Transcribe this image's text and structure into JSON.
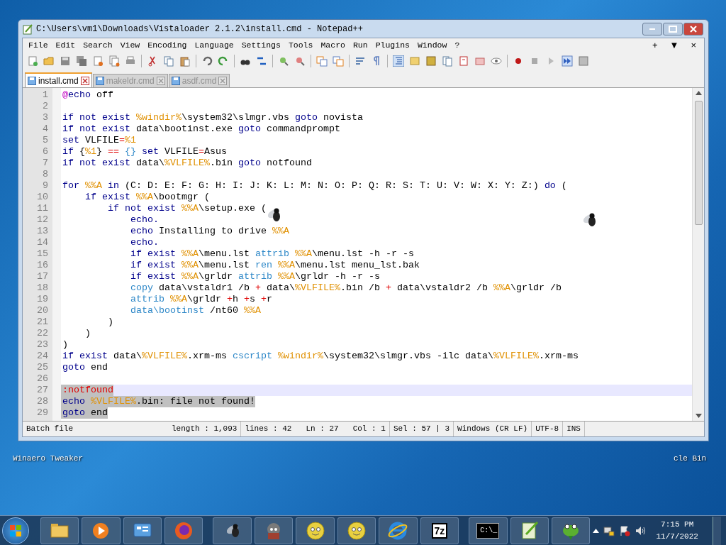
{
  "window": {
    "title": "C:\\Users\\vm1\\Downloads\\Vistaloader 2.1.2\\install.cmd - Notepad++"
  },
  "menu": [
    "File",
    "Edit",
    "Search",
    "View",
    "Encoding",
    "Language",
    "Settings",
    "Tools",
    "Macro",
    "Run",
    "Plugins",
    "Window",
    "?"
  ],
  "menu_right": [
    "+",
    "▼",
    "×"
  ],
  "tabs": [
    {
      "label": "install.cmd",
      "selected": true
    },
    {
      "label": "makeldr.cmd",
      "selected": false
    },
    {
      "label": "asdf.cmd",
      "selected": false
    }
  ],
  "editor": {
    "lines": [
      {
        "number": "1",
        "selected": false,
        "current": false,
        "segments": [
          {
            "text": "@",
            "kind": "at"
          },
          {
            "text": "echo",
            "kind": "kw"
          },
          {
            "text": " off",
            "kind": "p"
          }
        ]
      },
      {
        "number": "2",
        "selected": false,
        "current": false
      },
      {
        "number": "3",
        "selected": false,
        "current": false,
        "segments": [
          {
            "text": "if not exist ",
            "kind": "kw"
          },
          {
            "text": "%windir%",
            "kind": "var"
          },
          {
            "text": "\\system32\\slmgr.vbs ",
            "kind": "p"
          },
          {
            "text": "goto",
            "kind": "kw"
          },
          {
            "text": " novista",
            "kind": "p"
          }
        ]
      },
      {
        "number": "4",
        "selected": false,
        "current": false,
        "segments": [
          {
            "text": "if not exist",
            "kind": "kw"
          },
          {
            "text": " data\\bootinst.exe ",
            "kind": "p"
          },
          {
            "text": "goto",
            "kind": "kw"
          },
          {
            "text": " commandprompt",
            "kind": "p"
          }
        ]
      },
      {
        "number": "5",
        "selected": false,
        "current": false,
        "segments": [
          {
            "text": "set",
            "kind": "kw"
          },
          {
            "text": " VLFILE",
            "kind": "p"
          },
          {
            "text": "=",
            "kind": "op"
          },
          {
            "text": "%1",
            "kind": "var"
          }
        ]
      },
      {
        "number": "6",
        "selected": false,
        "current": false,
        "segments": [
          {
            "text": "if",
            "kind": "kw"
          },
          {
            "text": " {",
            "kind": "p"
          },
          {
            "text": "%1",
            "kind": "var"
          },
          {
            "text": "} ",
            "kind": "p"
          },
          {
            "text": "==",
            "kind": "op"
          },
          {
            "text": " {} ",
            "kind": "cmd"
          },
          {
            "text": "set",
            "kind": "kw"
          },
          {
            "text": " VLFILE",
            "kind": "p"
          },
          {
            "text": "=",
            "kind": "op"
          },
          {
            "text": "Asus",
            "kind": "p"
          }
        ]
      },
      {
        "number": "7",
        "selected": false,
        "current": false,
        "segments": [
          {
            "text": "if not exist",
            "kind": "kw"
          },
          {
            "text": " data\\",
            "kind": "p"
          },
          {
            "text": "%VLFILE%",
            "kind": "var"
          },
          {
            "text": ".bin ",
            "kind": "p"
          },
          {
            "text": "goto",
            "kind": "kw"
          },
          {
            "text": " notfound",
            "kind": "p"
          }
        ]
      },
      {
        "number": "8",
        "selected": false,
        "current": false
      },
      {
        "number": "9",
        "selected": false,
        "current": false,
        "segments": [
          {
            "text": "for ",
            "kind": "kw"
          },
          {
            "text": "%%A",
            "kind": "var"
          },
          {
            "text": " in",
            "kind": "kw"
          },
          {
            "text": " (C: D: E: F: G: H: I: J: K: L: M: N: O: P: Q: R: S: T: U: V: W: X: Y: Z:) ",
            "kind": "p"
          },
          {
            "text": "do",
            "kind": "kw"
          },
          {
            "text": " (",
            "kind": "p"
          }
        ]
      },
      {
        "number": "10",
        "selected": false,
        "current": false,
        "segments": [
          {
            "text": "    if exist ",
            "kind": "kw"
          },
          {
            "text": "%%A",
            "kind": "var"
          },
          {
            "text": "\\bootmgr (",
            "kind": "p"
          }
        ]
      },
      {
        "number": "11",
        "selected": false,
        "current": false,
        "segments": [
          {
            "text": "        if not exist ",
            "kind": "kw"
          },
          {
            "text": "%%A",
            "kind": "var"
          },
          {
            "text": "\\setup.exe (",
            "kind": "p"
          }
        ]
      },
      {
        "number": "12",
        "selected": false,
        "current": false,
        "segments": [
          {
            "text": "            echo.",
            "kind": "kw"
          }
        ]
      },
      {
        "number": "13",
        "selected": false,
        "current": false,
        "segments": [
          {
            "text": "            echo",
            "kind": "kw"
          },
          {
            "text": " Installing to drive ",
            "kind": "p"
          },
          {
            "text": "%%A",
            "kind": "var"
          }
        ]
      },
      {
        "number": "14",
        "selected": false,
        "current": false,
        "segments": [
          {
            "text": "            echo.",
            "kind": "kw"
          }
        ]
      },
      {
        "number": "15",
        "selected": false,
        "current": false,
        "segments": [
          {
            "text": "            if exist ",
            "kind": "kw"
          },
          {
            "text": "%%A",
            "kind": "var"
          },
          {
            "text": "\\menu.lst ",
            "kind": "p"
          },
          {
            "text": "attrib ",
            "kind": "cmd"
          },
          {
            "text": "%%A",
            "kind": "var"
          },
          {
            "text": "\\menu.lst -h -r -s",
            "kind": "p"
          }
        ]
      },
      {
        "number": "16",
        "selected": false,
        "current": false,
        "segments": [
          {
            "text": "            if exist ",
            "kind": "kw"
          },
          {
            "text": "%%A",
            "kind": "var"
          },
          {
            "text": "\\menu.lst ",
            "kind": "p"
          },
          {
            "text": "ren ",
            "kind": "cmd"
          },
          {
            "text": "%%A",
            "kind": "var"
          },
          {
            "text": "\\menu.lst menu_lst.bak",
            "kind": "p"
          }
        ]
      },
      {
        "number": "17",
        "selected": false,
        "current": false,
        "segments": [
          {
            "text": "            if exist ",
            "kind": "kw"
          },
          {
            "text": "%%A",
            "kind": "var"
          },
          {
            "text": "\\grldr ",
            "kind": "p"
          },
          {
            "text": "attrib ",
            "kind": "cmd"
          },
          {
            "text": "%%A",
            "kind": "var"
          },
          {
            "text": "\\grldr -h -r -s",
            "kind": "p"
          }
        ]
      },
      {
        "number": "18",
        "selected": false,
        "current": false,
        "segments": [
          {
            "text": "            copy",
            "kind": "cmd"
          },
          {
            "text": " data\\vstaldr1 /b ",
            "kind": "p"
          },
          {
            "text": "+",
            "kind": "op"
          },
          {
            "text": " data\\",
            "kind": "p"
          },
          {
            "text": "%VLFILE%",
            "kind": "var"
          },
          {
            "text": ".bin /b ",
            "kind": "p"
          },
          {
            "text": "+",
            "kind": "op"
          },
          {
            "text": " data\\vstaldr2 /b ",
            "kind": "p"
          },
          {
            "text": "%%A",
            "kind": "var"
          },
          {
            "text": "\\grldr /b",
            "kind": "p"
          }
        ]
      },
      {
        "number": "19",
        "selected": false,
        "current": false,
        "segments": [
          {
            "text": "            attrib ",
            "kind": "cmd"
          },
          {
            "text": "%%A",
            "kind": "var"
          },
          {
            "text": "\\grldr ",
            "kind": "p"
          },
          {
            "text": "+",
            "kind": "op"
          },
          {
            "text": "h ",
            "kind": "p"
          },
          {
            "text": "+",
            "kind": "op"
          },
          {
            "text": "s ",
            "kind": "p"
          },
          {
            "text": "+",
            "kind": "op"
          },
          {
            "text": "r",
            "kind": "p"
          }
        ]
      },
      {
        "number": "20",
        "selected": false,
        "current": false,
        "segments": [
          {
            "text": "            data\\bootinst",
            "kind": "cmd"
          },
          {
            "text": " /nt60 ",
            "kind": "p"
          },
          {
            "text": "%%A",
            "kind": "var"
          }
        ]
      },
      {
        "number": "21",
        "selected": false,
        "current": false,
        "segments": [
          {
            "text": "        )",
            "kind": "p"
          }
        ]
      },
      {
        "number": "22",
        "selected": false,
        "current": false,
        "segments": [
          {
            "text": "    )",
            "kind": "p"
          }
        ]
      },
      {
        "number": "23",
        "selected": false,
        "current": false,
        "segments": [
          {
            "text": ")",
            "kind": "p"
          }
        ]
      },
      {
        "number": "24",
        "selected": false,
        "current": false,
        "segments": [
          {
            "text": "if exist",
            "kind": "kw"
          },
          {
            "text": " data\\",
            "kind": "p"
          },
          {
            "text": "%VLFILE%",
            "kind": "var"
          },
          {
            "text": ".xrm-ms ",
            "kind": "p"
          },
          {
            "text": "cscript ",
            "kind": "cmd"
          },
          {
            "text": "%windir%",
            "kind": "var"
          },
          {
            "text": "\\system32\\slmgr.vbs -ilc data\\",
            "kind": "p"
          },
          {
            "text": "%VLFILE%",
            "kind": "var"
          },
          {
            "text": ".xrm-ms",
            "kind": "p"
          }
        ]
      },
      {
        "number": "25",
        "selected": false,
        "current": false,
        "segments": [
          {
            "text": "goto",
            "kind": "kw"
          },
          {
            "text": " end",
            "kind": "p"
          }
        ]
      },
      {
        "number": "26",
        "selected": false,
        "current": false
      },
      {
        "number": "27",
        "selected": true,
        "current": true,
        "segments": [
          {
            "text": ":notfound",
            "kind": "label"
          }
        ]
      },
      {
        "number": "28",
        "selected": true,
        "current": false,
        "segments": [
          {
            "text": "echo ",
            "kind": "kw"
          },
          {
            "text": "%VLFILE%",
            "kind": "var"
          },
          {
            "text": ".bin: file not found!",
            "kind": "p"
          }
        ]
      },
      {
        "number": "29",
        "selected": true,
        "current": false,
        "segments": [
          {
            "text": "goto",
            "kind": "kw"
          },
          {
            "text": " end",
            "kind": "p"
          }
        ]
      }
    ]
  },
  "status_bar": [
    "Batch file",
    "length : 1,093",
    "lines : 42",
    "Ln : 27",
    "Col : 1",
    "Sel : 57 | 3",
    "Windows (CR LF)",
    "UTF-8",
    "INS"
  ],
  "desktop_icons": [
    {
      "label": "Winaero Tweaker"
    },
    {
      "label": "cle Bin"
    }
  ],
  "taskbar": {
    "archive_label": "7z",
    "terminal_label": "C:\\_",
    "time": "7:15 PM",
    "date": "11/7/2022"
  }
}
